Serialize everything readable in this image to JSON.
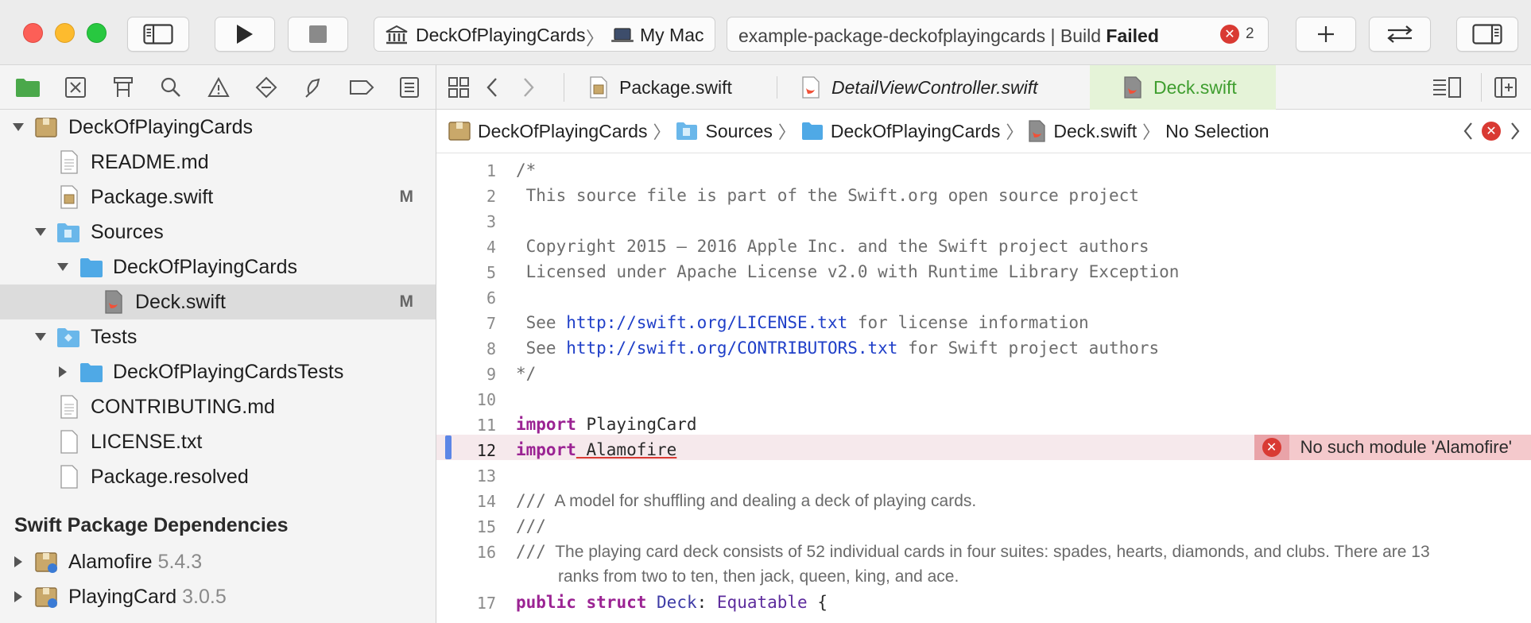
{
  "toolbar": {
    "scheme_target": "DeckOfPlayingCards",
    "scheme_device": "My Mac",
    "status_prefix": "example-package-deckofplayingcards | Build",
    "status_result": "Failed",
    "error_count": "2",
    "icons": [
      "sidebar-icon",
      "run-icon",
      "stop-icon",
      "add-icon",
      "code-review-icon",
      "inspector-icon"
    ]
  },
  "navigator_bar": {
    "icons": [
      "folder-icon",
      "source-control-icon",
      "symbol-icon",
      "find-icon",
      "issue-icon",
      "test-icon",
      "debug-icon",
      "breakpoint-icon",
      "report-icon"
    ]
  },
  "tree": {
    "root": "DeckOfPlayingCards",
    "readme": "README.md",
    "package": "Package.swift",
    "package_badge": "M",
    "sources": "Sources",
    "sources_folder": "DeckOfPlayingCards",
    "deck": "Deck.swift",
    "deck_badge": "M",
    "tests": "Tests",
    "tests_folder": "DeckOfPlayingCardsTests",
    "contributing": "CONTRIBUTING.md",
    "license": "LICENSE.txt",
    "resolved": "Package.resolved"
  },
  "dependencies": {
    "title": "Swift Package Dependencies",
    "items": [
      {
        "name": "Alamofire",
        "version": "5.4.3"
      },
      {
        "name": "PlayingCard",
        "version": "3.0.5"
      }
    ]
  },
  "tabs": [
    {
      "label": "Package.swift"
    },
    {
      "label": "DetailViewController.swift"
    },
    {
      "label": "Deck.swift"
    }
  ],
  "jumpbar": {
    "crumbs": [
      "DeckOfPlayingCards",
      "Sources",
      "DeckOfPlayingCards",
      "Deck.swift",
      "No Selection"
    ]
  },
  "editor": {
    "line_numbers": [
      "1",
      "2",
      "3",
      "4",
      "5",
      "6",
      "7",
      "8",
      "9",
      "10",
      "11",
      "12",
      "13",
      "14",
      "15",
      "16",
      "17"
    ],
    "l1": "/*",
    "l2": " This source file is part of the Swift.org open source project",
    "l4": " Copyright 2015 – 2016 Apple Inc. and the Swift project authors",
    "l5": " Licensed under Apache License v2.0 with Runtime Library Exception",
    "l7_pre": " See ",
    "l7_url": "http://swift.org/LICENSE.txt",
    "l7_post": " for license information",
    "l8_pre": " See ",
    "l8_url": "http://swift.org/CONTRIBUTORS.txt",
    "l8_post": " for Swift project authors",
    "l9": "*/",
    "kw_import": "import",
    "l11_module": " PlayingCard",
    "l12_module": " Alamofire",
    "error_message": "No such module 'Alamofire'",
    "doc_prefix": "///",
    "l14_doc": "A model for shuffling and dealing a deck of playing cards.",
    "l16_doc_a": "The playing card deck consists of 52 individual cards in four suites: spades, hearts, diamonds, and clubs. There are 13",
    "l16_doc_b": "ranks from two to ten, then jack, queen, king, and ace.",
    "l17_public": "public",
    "l17_struct": "struct",
    "l17_name": "Deck",
    "l17_proto": "Equatable",
    "l17_brace": " {"
  }
}
